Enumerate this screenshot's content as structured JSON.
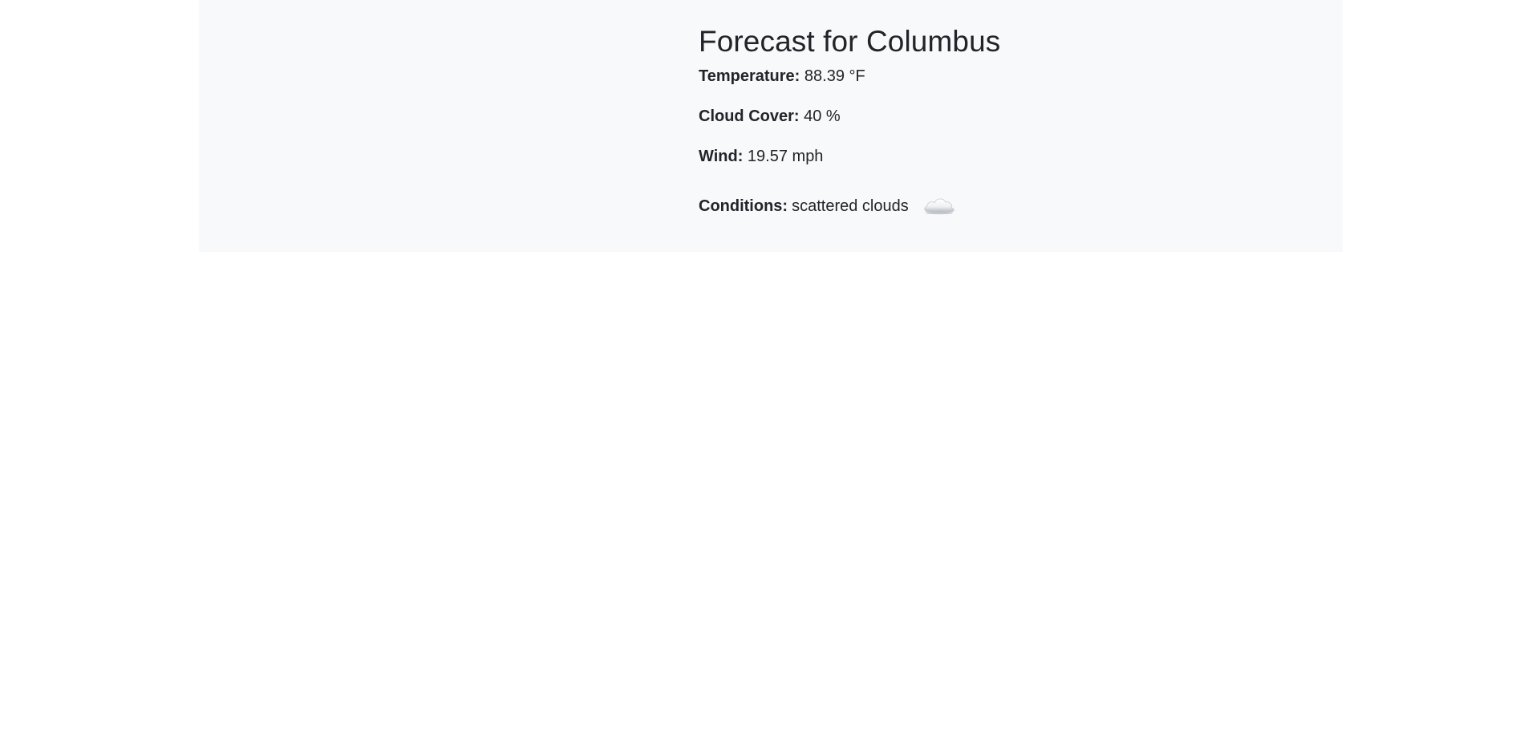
{
  "page": {
    "title": "Forecast for Columbus"
  },
  "weather": {
    "temperature_label": "Temperature:",
    "temperature_value": "88.39 °F",
    "cloud_cover_label": "Cloud Cover:",
    "cloud_cover_value": "40 %",
    "wind_label": "Wind:",
    "wind_value": "19.57 mph",
    "conditions_label": "Conditions:",
    "conditions_value": "scattered clouds",
    "conditions_icon": "cloud-icon"
  },
  "colors": {
    "panel_background": "#f8f9fa",
    "text": "#212529"
  }
}
